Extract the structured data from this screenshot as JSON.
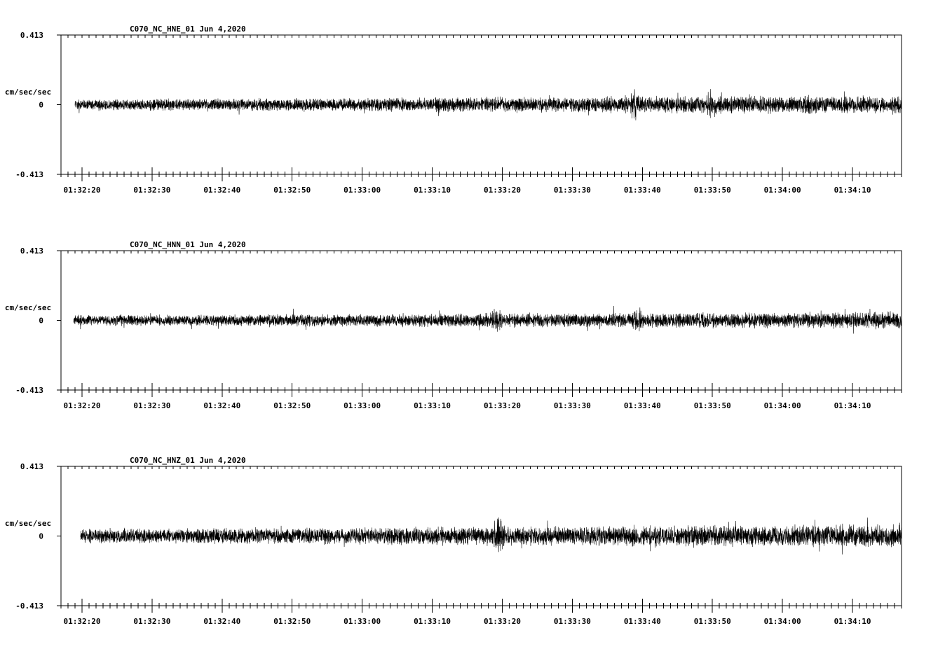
{
  "chart_data": [
    {
      "type": "line",
      "title": "C070_NC_HNE_01   Jun 4,2020",
      "ylabel": "cm/sec/sec",
      "ylim": [
        -0.413,
        0.413
      ],
      "yticks": [
        "0.413",
        "0",
        "-0.413"
      ],
      "xticks": [
        "01:32:20",
        "01:32:30",
        "01:32:40",
        "01:32:50",
        "01:33:00",
        "01:33:10",
        "01:33:20",
        "01:33:30",
        "01:33:40",
        "01:33:50",
        "01:34:00",
        "01:34:10"
      ],
      "xrange_seconds": [
        17,
        137
      ],
      "trace_start_seconds": 19,
      "noise_amplitude": 0.06,
      "events": [
        {
          "t": 99.0,
          "amp": 0.14
        },
        {
          "t": 110.0,
          "amp": 0.1
        }
      ],
      "seed": 7
    },
    {
      "type": "line",
      "title": "C070_NC_HNN_01   Jun 4,2020",
      "ylabel": "cm/sec/sec",
      "ylim": [
        -0.413,
        0.413
      ],
      "yticks": [
        "0.413",
        "0",
        "-0.413"
      ],
      "xticks": [
        "01:32:20",
        "01:32:30",
        "01:32:40",
        "01:32:50",
        "01:33:00",
        "01:33:10",
        "01:33:20",
        "01:33:30",
        "01:33:40",
        "01:33:50",
        "01:34:00",
        "01:34:10"
      ],
      "xrange_seconds": [
        17,
        137
      ],
      "trace_start_seconds": 18.8,
      "noise_amplitude": 0.055,
      "events": [
        {
          "t": 79.2,
          "amp": 0.09
        },
        {
          "t": 99.4,
          "amp": 0.1
        }
      ],
      "seed": 13
    },
    {
      "type": "line",
      "title": "C070_NC_HNZ_01   Jun 4,2020",
      "ylabel": "cm/sec/sec",
      "ylim": [
        -0.413,
        0.413
      ],
      "yticks": [
        "0.413",
        "0",
        "-0.413"
      ],
      "xticks": [
        "01:32:20",
        "01:32:30",
        "01:32:40",
        "01:32:50",
        "01:33:00",
        "01:33:10",
        "01:33:20",
        "01:33:30",
        "01:33:40",
        "01:33:50",
        "01:34:00",
        "01:34:10"
      ],
      "xrange_seconds": [
        17,
        137
      ],
      "trace_start_seconds": 19.8,
      "noise_amplitude": 0.075,
      "events": [
        {
          "t": 79.4,
          "amp": 0.17
        }
      ],
      "seed": 29
    }
  ]
}
